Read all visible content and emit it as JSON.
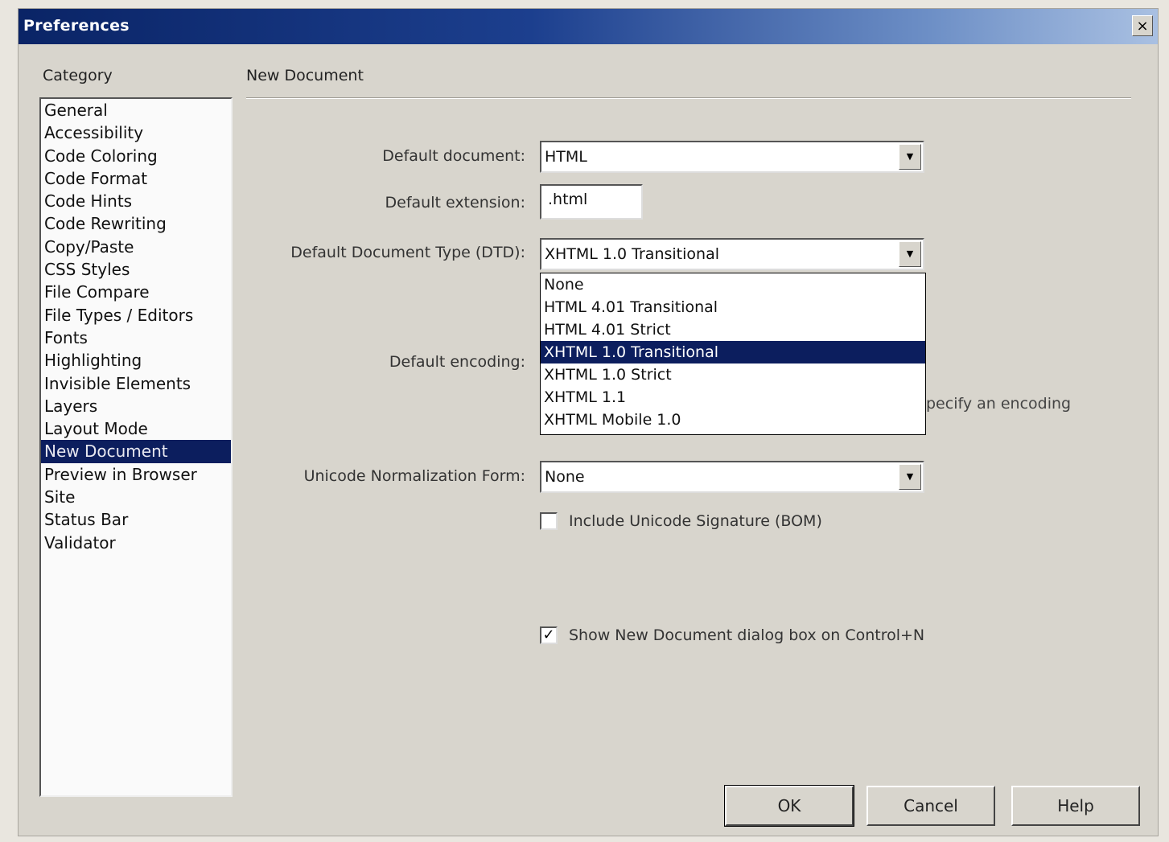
{
  "window": {
    "title": "Preferences",
    "close_label": "×"
  },
  "category": {
    "heading": "Category",
    "items": [
      "General",
      "Accessibility",
      "Code Coloring",
      "Code Format",
      "Code Hints",
      "Code Rewriting",
      "Copy/Paste",
      "CSS Styles",
      "File Compare",
      "File Types / Editors",
      "Fonts",
      "Highlighting",
      "Invisible Elements",
      "Layers",
      "Layout Mode",
      "New Document",
      "Preview in Browser",
      "Site",
      "Status Bar",
      "Validator"
    ],
    "selected": "New Document"
  },
  "panel": {
    "heading": "New Document",
    "default_document": {
      "label": "Default document:",
      "value": "HTML"
    },
    "default_extension": {
      "label": "Default extension:",
      "value": ".html"
    },
    "dtd": {
      "label": "Default Document Type (DTD):",
      "value": "XHTML 1.0 Transitional",
      "options": [
        "None",
        "HTML 4.01 Transitional",
        "HTML 4.01 Strict",
        "XHTML 1.0 Transitional",
        "XHTML 1.0 Strict",
        "XHTML 1.1",
        "XHTML Mobile 1.0"
      ],
      "selected_option": "XHTML 1.0 Transitional"
    },
    "default_encoding": {
      "label": "Default encoding:",
      "hint": "pecify an encoding"
    },
    "unicode_normalization": {
      "label": "Unicode Normalization Form:",
      "value": "None"
    },
    "include_bom": {
      "label": "Include Unicode Signature (BOM)",
      "checked": false
    },
    "show_new_doc_dialog": {
      "label": "Show New Document dialog box on Control+N",
      "checked": true
    }
  },
  "buttons": {
    "ok": "OK",
    "cancel": "Cancel",
    "help": "Help"
  },
  "colors": {
    "selection": "#0c1e5e",
    "dialog_bg": "#d8d5cd",
    "title_gradient_start": "#0a2466"
  }
}
